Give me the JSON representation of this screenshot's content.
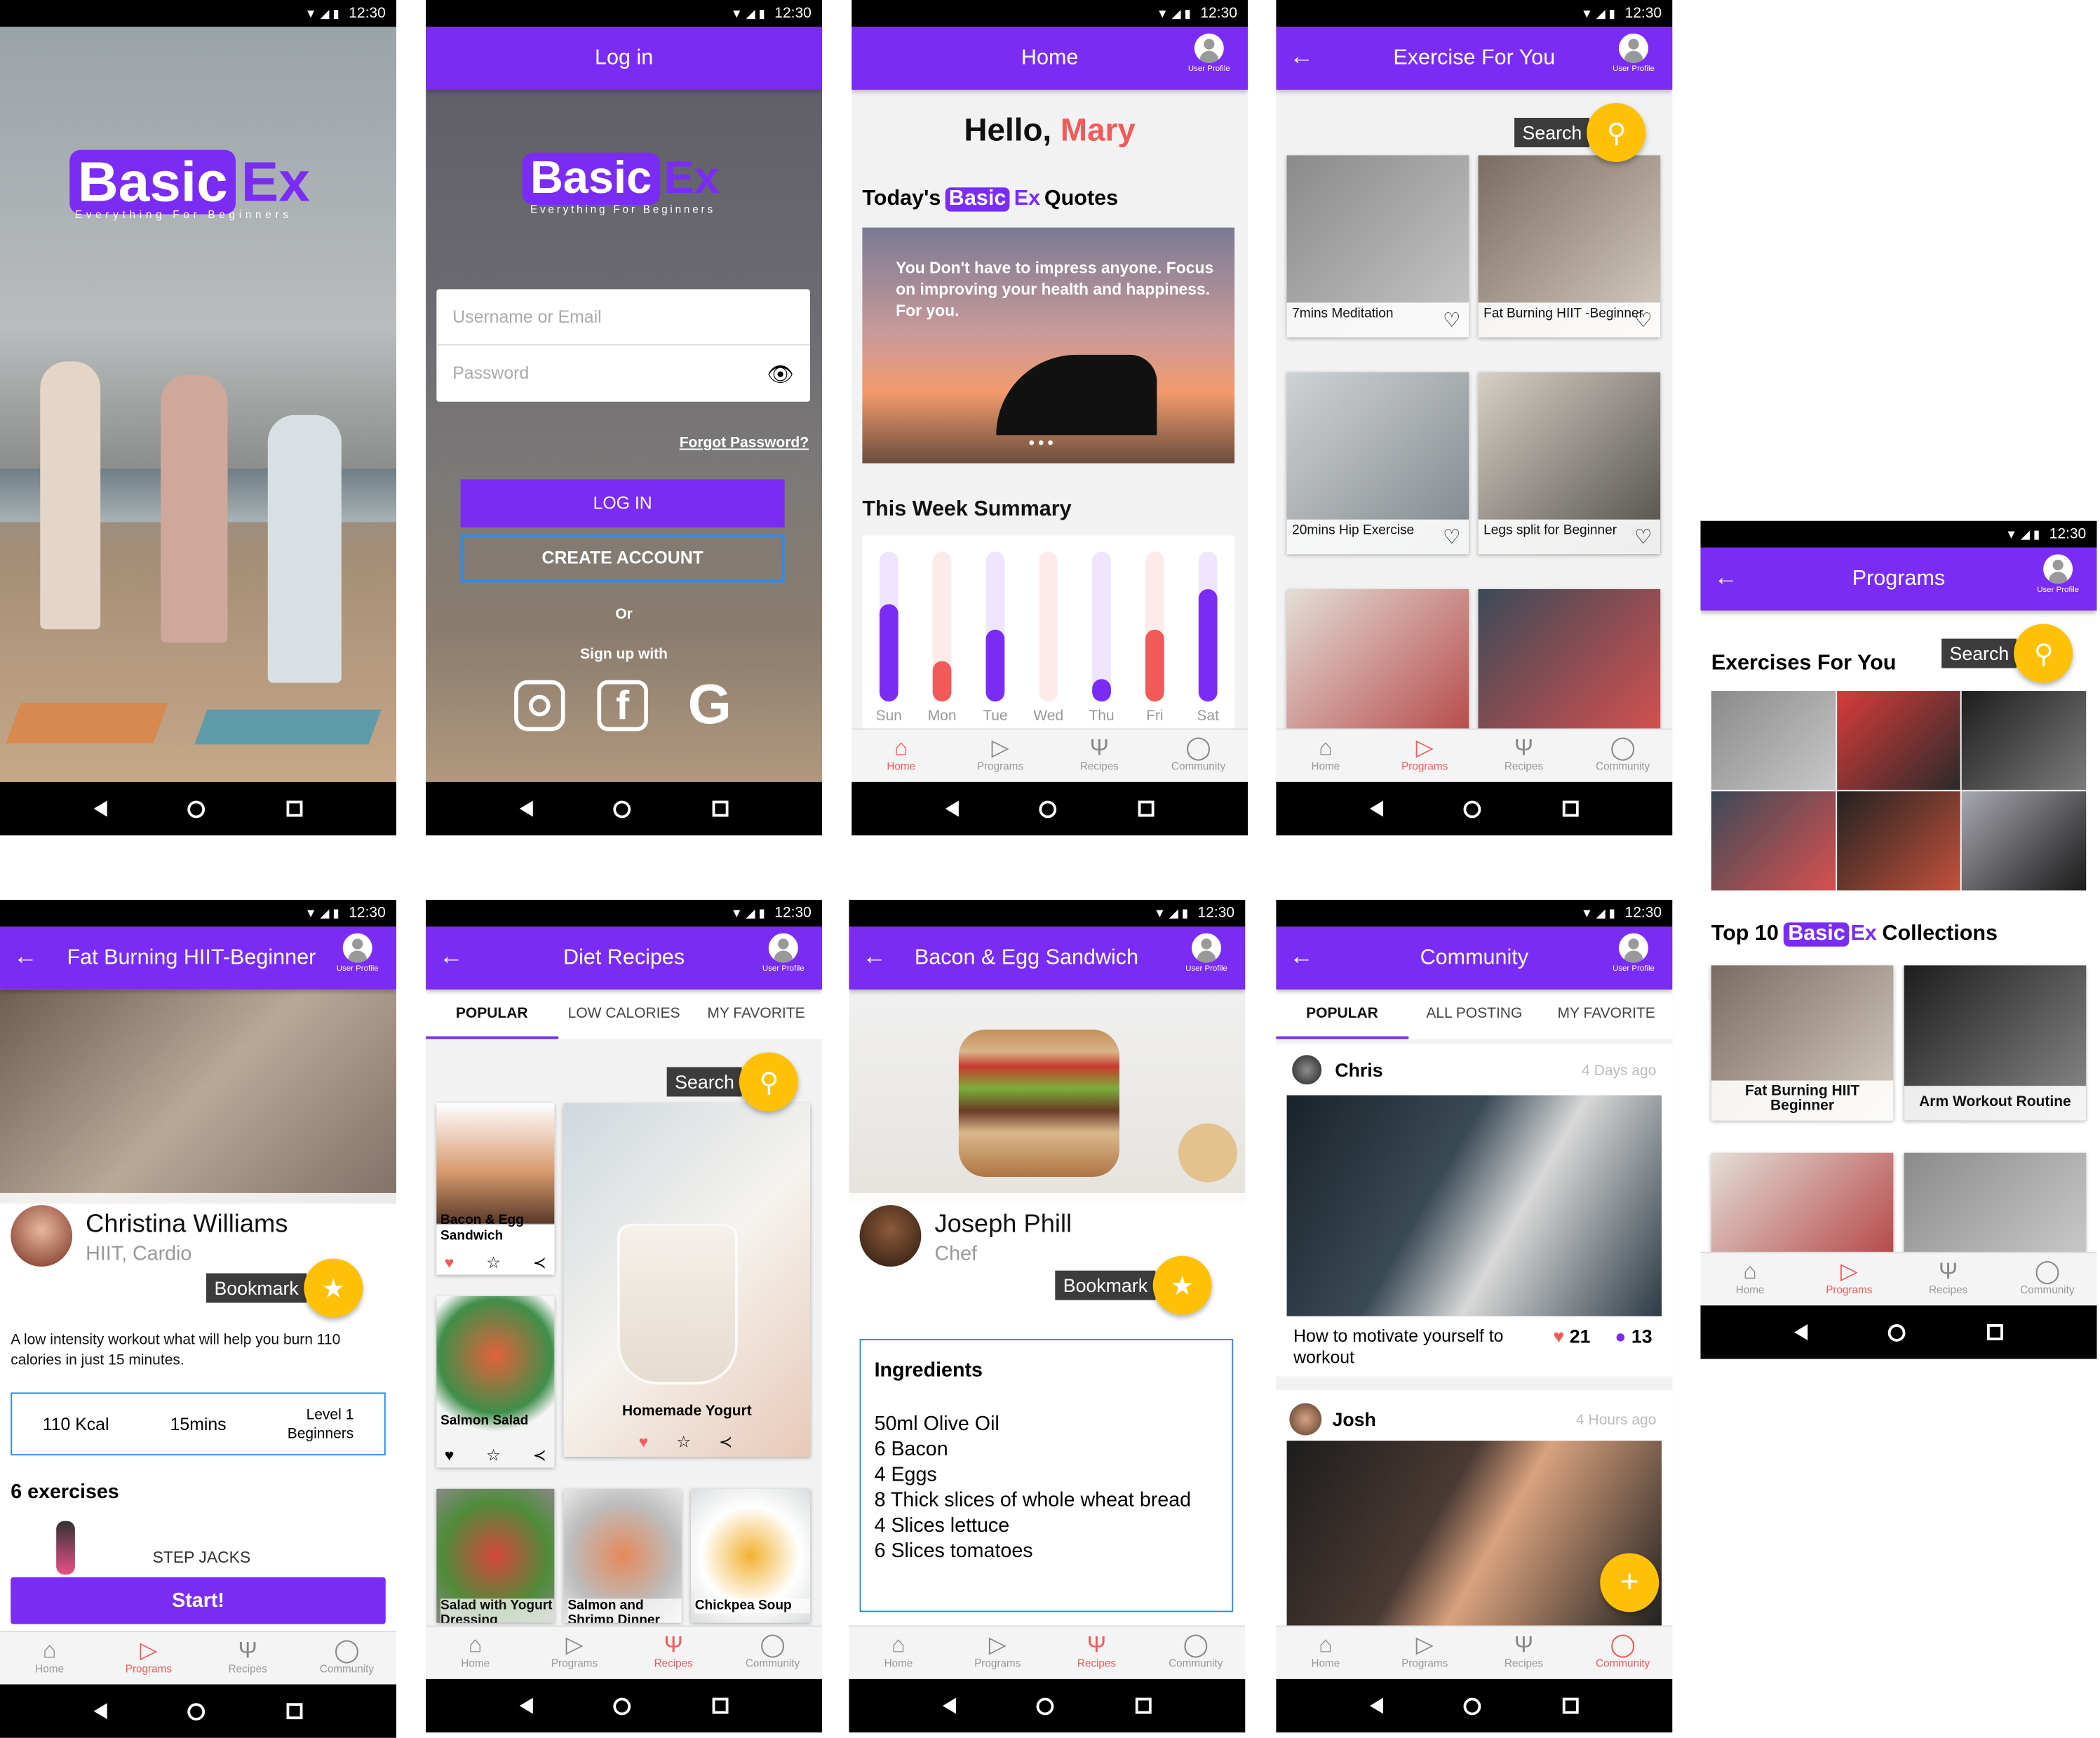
{
  "status": {
    "time": "12:30"
  },
  "common": {
    "user_profile": "User Profile",
    "tabs": [
      "Home",
      "Programs",
      "Recipes",
      "Community"
    ],
    "search": "Search",
    "bookmark": "Bookmark"
  },
  "splash": {
    "logo_basic": "Basic",
    "logo_ex": "Ex",
    "tagline": "Everything For Beginners"
  },
  "login": {
    "title": "Log in",
    "username_placeholder": "Username or Email",
    "password_placeholder": "Password",
    "forgot": "Forgot Password?",
    "login_button": "LOG IN",
    "create_button": "CREATE ACCOUNT",
    "or": "Or",
    "signup_with": "Sign up with"
  },
  "home": {
    "title": "Home",
    "hello": "Hello,",
    "name": "Mary",
    "quotes_prefix": "Today's",
    "quotes_suffix": "Quotes",
    "quote": "You Don't have to impress anyone. Focus on improving your health and happiness. For you.",
    "summary_title": "This Week Summary"
  },
  "chart_data": {
    "type": "bar",
    "categories": [
      "Sun",
      "Mon",
      "Tue",
      "Wed",
      "Thu",
      "Fri",
      "Sat"
    ],
    "values": [
      0.65,
      0.27,
      0.48,
      0,
      0.15,
      0.48,
      0.75
    ],
    "colors": [
      "#7a2cf5",
      "#f25a5a",
      "#7a2cf5",
      "#f25a5a",
      "#7a2cf5",
      "#f25a5a",
      "#7a2cf5"
    ]
  },
  "exercise": {
    "title": "Exercise For You",
    "cards": [
      "7mins Meditation",
      "Fat Burning HIIT -Beginner",
      "20mins Hip Exercise",
      "Legs split for Beginner"
    ]
  },
  "programs": {
    "title": "Programs",
    "section": "Exercises For You",
    "top10_prefix": "Top 10",
    "top10_suffix": "Collections",
    "collections": [
      "Fat Burning HIIT Beginner",
      "Arm Workout Routine"
    ]
  },
  "hiit": {
    "title": "Fat Burning HIIT-Beginner",
    "trainer": "Christina Williams",
    "trainer_sub": "HIIT, Cardio",
    "desc": "A low intensity workout what will help you burn 110 calories in just 15 minutes.",
    "kcal": "110 Kcal",
    "mins": "15mins",
    "level": "Level 1",
    "level_sub": "Beginners",
    "exercises_title": "6 exercises",
    "exercise_item": "STEP JACKS",
    "start": "Start!"
  },
  "recipes": {
    "title": "Diet Recipes",
    "tabs": [
      "POPULAR",
      "LOW CALORIES",
      "MY FAVORITE"
    ],
    "items": [
      "Bacon & Egg Sandwich",
      "Salmon Salad",
      "Homemade Yogurt",
      "Salad with Yogurt Dressing",
      "Salmon and Shrimp Dinner",
      "Chickpea Soup"
    ]
  },
  "bacon": {
    "title": "Bacon & Egg Sandwich",
    "chef": "Joseph Phill",
    "chef_role": "Chef",
    "ingredients_title": "Ingredients",
    "ingredients": [
      "50ml Olive Oil",
      "6 Bacon",
      "4 Eggs",
      "8 Thick slices of whole wheat bread",
      "4 Slices lettuce",
      "6 Slices tomatoes"
    ]
  },
  "community": {
    "title": "Community",
    "tabs": [
      "POPULAR",
      "ALL POSTING",
      "MY FAVORITE"
    ],
    "posts": [
      {
        "user": "Chris",
        "time": "4 Days ago",
        "text": "How to motivate yourself to workout",
        "likes": "21",
        "comments": "13"
      },
      {
        "user": "Josh",
        "time": "4 Hours ago"
      }
    ]
  }
}
